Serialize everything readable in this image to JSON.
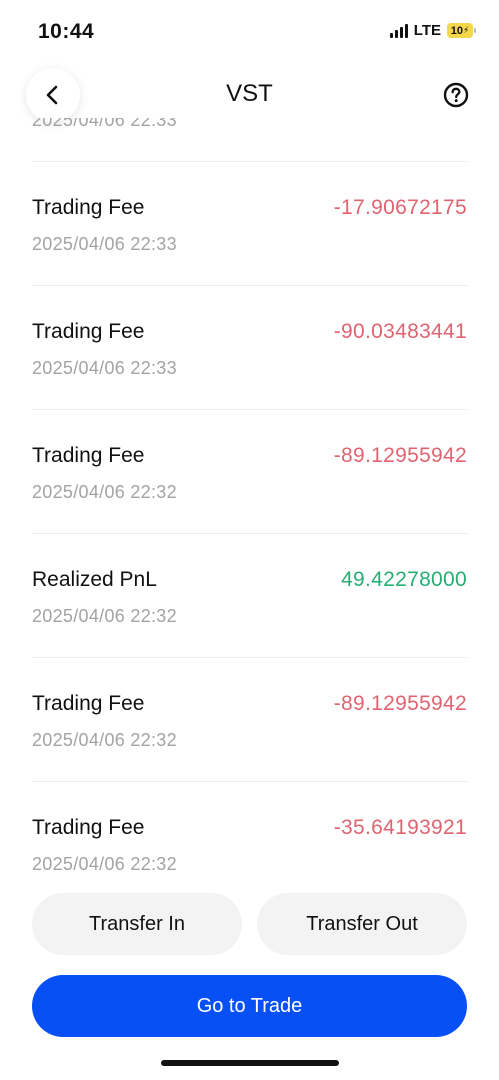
{
  "status_bar": {
    "time": "10:44",
    "network": "LTE",
    "battery": "10"
  },
  "header": {
    "title": "VST",
    "back_icon": "chevron-left-icon",
    "help_icon": "question-circle-icon"
  },
  "records": [
    {
      "type": "",
      "amount": "",
      "time": "2025/04/06 22:33",
      "direction": "neg"
    },
    {
      "type": "Trading Fee",
      "amount": "-17.90672175",
      "time": "2025/04/06 22:33",
      "direction": "neg"
    },
    {
      "type": "Trading Fee",
      "amount": "-90.03483441",
      "time": "2025/04/06 22:33",
      "direction": "neg"
    },
    {
      "type": "Trading Fee",
      "amount": "-89.12955942",
      "time": "2025/04/06 22:32",
      "direction": "neg"
    },
    {
      "type": "Realized PnL",
      "amount": "49.42278000",
      "time": "2025/04/06 22:32",
      "direction": "pos"
    },
    {
      "type": "Trading Fee",
      "amount": "-89.12955942",
      "time": "2025/04/06 22:32",
      "direction": "neg"
    },
    {
      "type": "Trading Fee",
      "amount": "-35.64193921",
      "time": "2025/04/06 22:32",
      "direction": "neg"
    }
  ],
  "actions": {
    "transfer_in": "Transfer In",
    "transfer_out": "Transfer Out",
    "go_to_trade": "Go to Trade"
  },
  "colors": {
    "negative": "#e06371",
    "positive": "#27ae74",
    "primary": "#0750f5"
  }
}
